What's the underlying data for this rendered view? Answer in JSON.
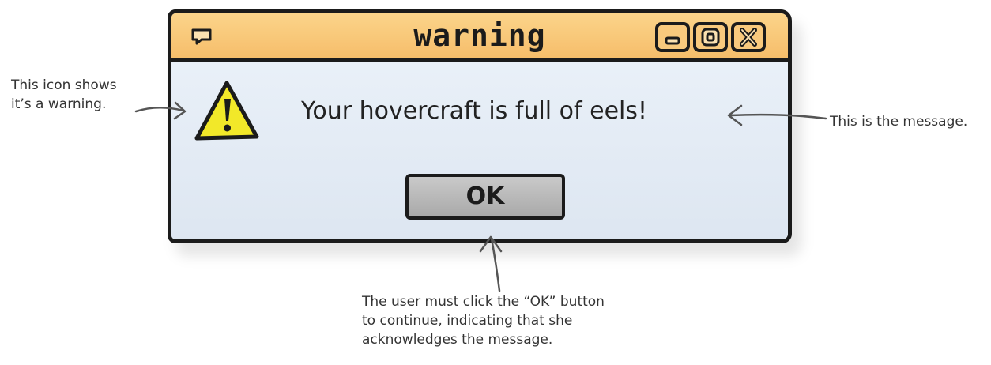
{
  "dialog": {
    "title": "warning",
    "message": "Your hovercraft is full of eels!",
    "ok_label": "OK",
    "icons": {
      "window": "window-icon",
      "warning": "warning-triangle-icon",
      "minimize": "minimize-icon",
      "maximize": "maximize-icon",
      "close": "close-icon"
    },
    "colors": {
      "titlebar": "#f6bd6a",
      "body": "#e3ecf6",
      "warning_fill": "#f2e829",
      "button": "#b8b8b8",
      "outline": "#1b1b1b"
    }
  },
  "annotations": {
    "icon_note": [
      "This icon shows",
      "it’s a warning."
    ],
    "message_note": "This is the message.",
    "ok_note": [
      "The user must click the “OK” button",
      "to continue, indicating that she",
      "acknowledges the message."
    ]
  }
}
